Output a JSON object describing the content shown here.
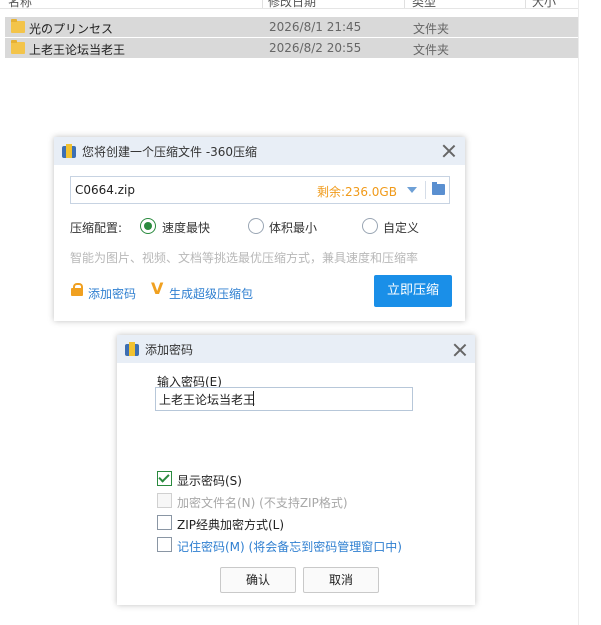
{
  "explorer": {
    "header": {
      "col_name": "名称",
      "col_date": "修改日期",
      "col_type": "类型",
      "col_size": "大小"
    },
    "files": [
      {
        "name": "光のプリンセス",
        "date": "2026/8/1 21:45",
        "type": "文件夹"
      },
      {
        "name": "上老王论坛当老王",
        "date": "2026/8/2 20:55",
        "type": "文件夹"
      }
    ]
  },
  "compress_dialog": {
    "title": "您将创建一个压缩文件 -360压缩",
    "filename": "C0664.zip",
    "remaining": "剩余:236.0GB",
    "config_label": "压缩配置:",
    "options": [
      {
        "label": "速度最快",
        "selected": true
      },
      {
        "label": "体积最小",
        "selected": false
      },
      {
        "label": "自定义",
        "selected": false
      }
    ],
    "hint": "智能为图片、视频、文档等挑选最优压缩方式，兼具速度和压缩率",
    "add_password": "添加密码",
    "super_pack": "生成超级压缩包",
    "compress_now": "立即压缩"
  },
  "password_dialog": {
    "title": "添加密码",
    "input_label": "输入密码(E)",
    "input_value": "上老王论坛当老王",
    "show_password": {
      "label": "显示密码(S)",
      "checked": true
    },
    "encrypt_filenames": {
      "label": "加密文件名(N) (不支持ZIP格式)",
      "enabled": false
    },
    "zip_classic": {
      "label": "ZIP经典加密方式(L)",
      "checked": false
    },
    "remember_password": {
      "label": "记住密码(M) (将会备忘到密码管理窗口中)",
      "checked": false
    },
    "ok": "确认",
    "cancel": "取消"
  },
  "colors": {
    "accent": "#1a8fe8",
    "remaining": "#f09a1a",
    "check": "#2a8a3e",
    "link": "#2f7fd0"
  }
}
